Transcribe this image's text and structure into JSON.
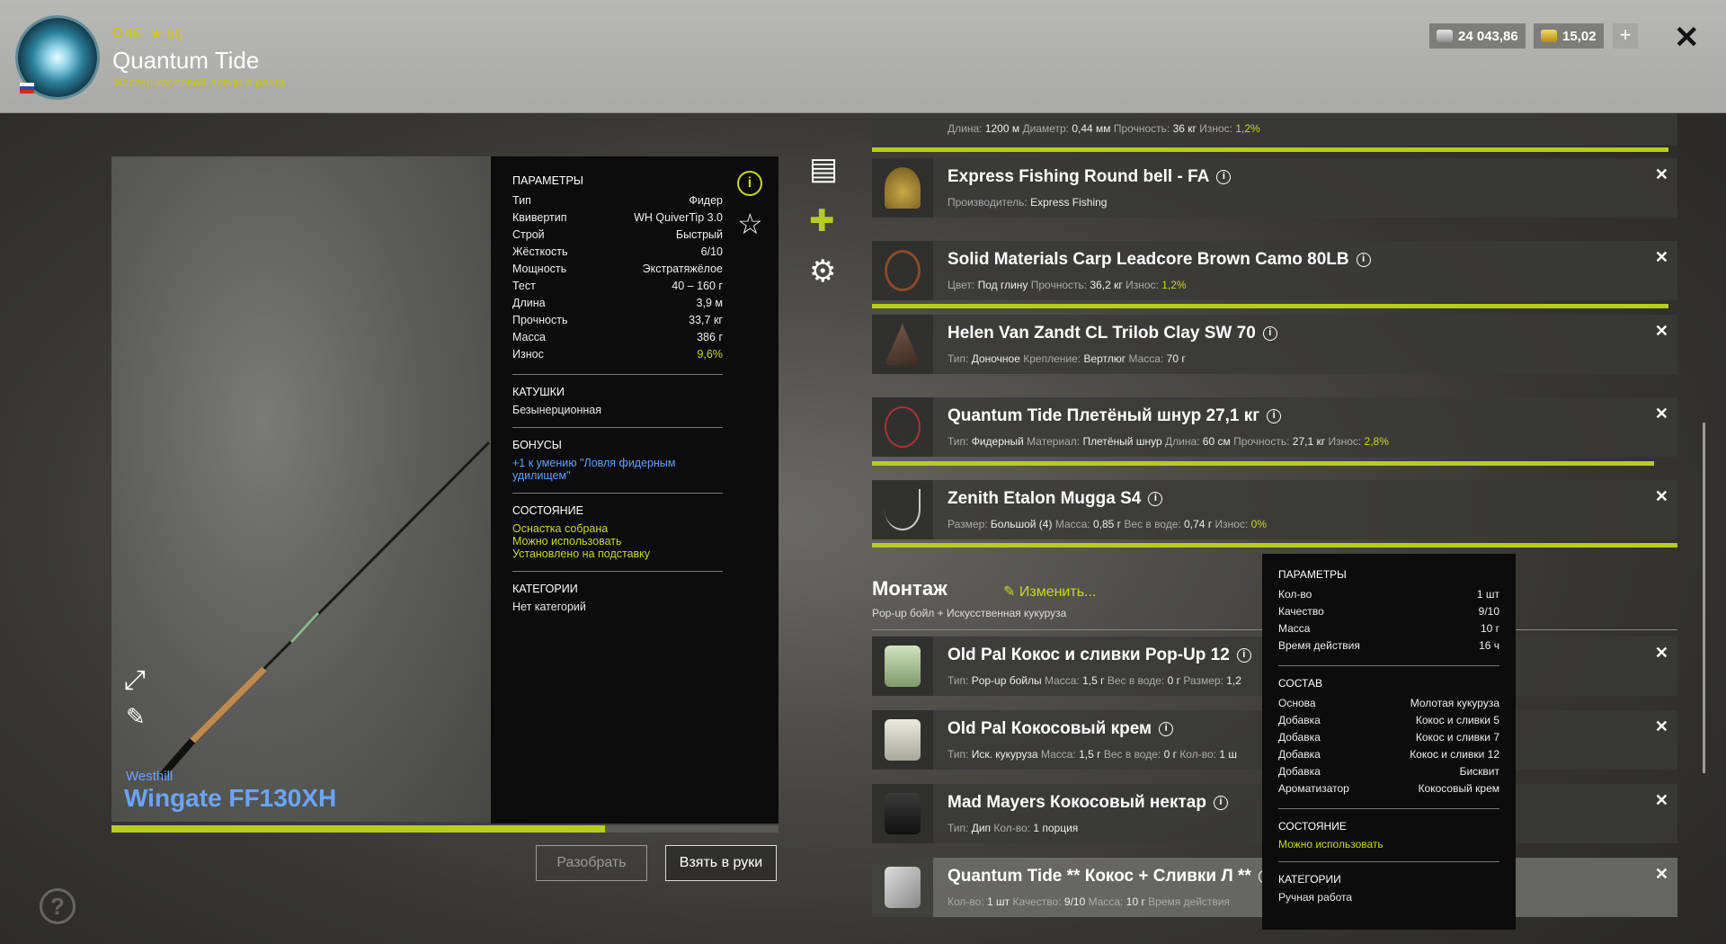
{
  "header": {
    "level": "46",
    "stars": "50",
    "player_name": "Quantum Tide",
    "rank": "Мастер карповой ловли 4 ранга",
    "silver": "24 043,86",
    "gold": "15,02",
    "plus_icon": "plus-icon",
    "close_icon": "close-icon"
  },
  "rod": {
    "brand": "Westhill",
    "name": "Wingate FF130XH",
    "condition_progress_fraction": 0.74
  },
  "stats": {
    "params_header": "ПАРАМЕТРЫ",
    "params": [
      {
        "label": "Тип",
        "value": "Фидер"
      },
      {
        "label": "Квивертип",
        "value": "WH QuiverTip 3.0"
      },
      {
        "label": "Строй",
        "value": "Быстрый"
      },
      {
        "label": "Жёсткость",
        "value": "6/10"
      },
      {
        "label": "Мощность",
        "value": "Экстратяжёлое"
      },
      {
        "label": "Тест",
        "value": "40 – 160 г"
      },
      {
        "label": "Длина",
        "value": "3,9 м"
      },
      {
        "label": "Прочность",
        "value": "33,7 кг"
      },
      {
        "label": "Масса",
        "value": "386 г"
      },
      {
        "label": "Износ",
        "value": "9,6%"
      }
    ],
    "reels_header": "КАТУШКИ",
    "reels_value": "Безынерционная",
    "bonus_header": "БОНУСЫ",
    "bonus_value": "+1 к умению \"Ловля фидерным удилищем\"",
    "state_header": "СОСТОЯНИЕ",
    "state_1": "Оснастка собрана",
    "state_2": "Можно использовать",
    "state_3": "Установлено на подставку",
    "cat_header": "КАТЕГОРИИ",
    "cat_value": "Нет категорий"
  },
  "buttons": {
    "disassemble": "Разобрать",
    "take": "Взять в руки"
  },
  "top_partial": {
    "label_len": "Длина:",
    "len": "1200 м",
    "label_diam": "Диаметр:",
    "diam": "0,44 мм",
    "label_str": "Прочность:",
    "str": "36 кг",
    "label_wear": "Износ:",
    "wear": "1,2%"
  },
  "items": [
    {
      "title": "Express Fishing Round bell - FA",
      "l1": "Производитель:",
      "v1": "Express Fishing"
    },
    {
      "title": "Solid Materials Carp Leadcore Brown Camo 80LB",
      "l1": "Цвет:",
      "v1": "Под глину",
      "l2": "Прочность:",
      "v2": "36,2 кг",
      "l3": "Износ:",
      "v3": "1,2%"
    },
    {
      "title": "Helen Van Zandt CL Trilob Clay SW 70",
      "l1": "Тип:",
      "v1": "Доночное",
      "l2": "Крепление:",
      "v2": "Вертлюг",
      "l3": "Масса:",
      "v3": "70 г"
    },
    {
      "title": "Quantum Tide Плетёный шнур 27,1 кг",
      "l1": "Тип:",
      "v1": "Фидерный",
      "l2": "Материал:",
      "v2": "Плетёный шнур",
      "l3": "Длина:",
      "v3": "60 см",
      "l4": "Прочность:",
      "v4": "27,1 кг",
      "l5": "Износ:",
      "v5": "2,8%"
    },
    {
      "title": "Zenith Etalon Mugga S4",
      "l1": "Размер:",
      "v1": "Большой (4)",
      "l2": "Масса:",
      "v2": "0,85 г",
      "l3": "Вес в воде:",
      "v3": "0,74 г",
      "l4": "Износ:",
      "v4": "0%"
    }
  ],
  "montage": {
    "title": "Монтаж",
    "edit": "Изменить...",
    "subtitle": "Pop-up бойл  +  Искусственная кукуруза"
  },
  "baits": [
    {
      "title": "Old Pal Кокос и сливки Pop-Up 12",
      "l1": "Тип:",
      "v1": "Pop-up бойлы",
      "l2": "Масса:",
      "v2": "1,5 г",
      "l3": "Вес в воде:",
      "v3": "0 г",
      "l4": "Размер:",
      "v4": "1,2"
    },
    {
      "title": "Old Pal Кокосовый крем",
      "l1": "Тип:",
      "v1": "Иск. кукуруза",
      "l2": "Масса:",
      "v2": "1,5 г",
      "l3": "Вес в воде:",
      "v3": "0 г",
      "l4": "Кол-во:",
      "v4": "1 ш"
    },
    {
      "title": "Mad Mayers Кокосовый нектар",
      "l1": "Тип:",
      "v1": "Дип",
      "l2": "Кол-во:",
      "v2": "1 порция"
    },
    {
      "title": "Quantum Tide ** Кокос + Сливки Л **",
      "l1": "Кол-во:",
      "v1": "1 шт",
      "l2": "Качество:",
      "v2": "9/10",
      "l3": "Масса:",
      "v3": "10 г",
      "l4": "Время действия",
      "v4": ""
    }
  ],
  "tooltip": {
    "params_header": "ПАРАМЕТРЫ",
    "params": [
      {
        "label": "Кол-во",
        "value": "1 шт"
      },
      {
        "label": "Качество",
        "value": "9/10"
      },
      {
        "label": "Масса",
        "value": "10 г"
      },
      {
        "label": "Время действия",
        "value": "16 ч"
      }
    ],
    "comp_header": "СОСТАВ",
    "comp": [
      {
        "label": "Основа",
        "value": "Молотая кукуруза"
      },
      {
        "label": "Добавка",
        "value": "Кокос и сливки 5"
      },
      {
        "label": "Добавка",
        "value": "Кокос и сливки 7"
      },
      {
        "label": "Добавка",
        "value": "Кокос и сливки 12"
      },
      {
        "label": "Добавка",
        "value": "Бисквит"
      },
      {
        "label": "Ароматизатор",
        "value": "Кокосовый крем"
      }
    ],
    "state_header": "СОСТОЯНИЕ",
    "state_value": "Можно использовать",
    "cat_header": "КАТЕГОРИИ",
    "cat_value": "Ручная работа"
  },
  "colors": {
    "accent": "#b7cc20",
    "blue": "#69a4ff"
  }
}
